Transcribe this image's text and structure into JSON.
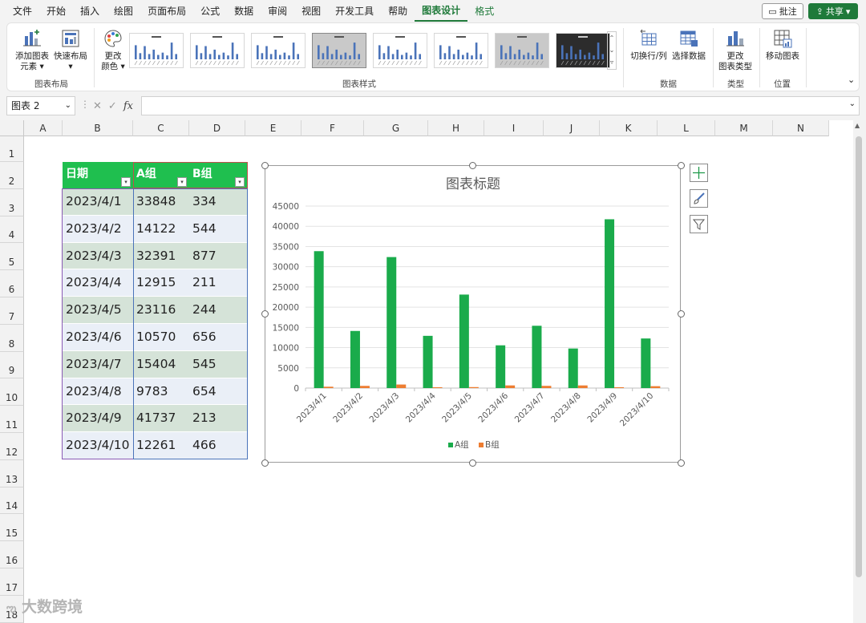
{
  "menu": [
    "文件",
    "开始",
    "插入",
    "绘图",
    "页面布局",
    "公式",
    "数据",
    "审阅",
    "视图",
    "开发工具",
    "帮助",
    "图表设计",
    "格式"
  ],
  "menu_active": "图表设计",
  "topright": {
    "comment": "批注",
    "share": "共享"
  },
  "ribbon": {
    "add_element_line1": "添加图表",
    "add_element_line2": "元素",
    "quick_layout": "快速布局",
    "change_color_line1": "更改",
    "change_color_line2": "颜色",
    "group_layout": "图表布局",
    "group_styles": "图表样式",
    "switch_row_col": "切换行/列",
    "select_data": "选择数据",
    "group_data": "数据",
    "change_type_line1": "更改",
    "change_type_line2": "图表类型",
    "group_type": "类型",
    "move_chart": "移动图表",
    "group_location": "位置"
  },
  "formula_bar": {
    "name_box": "图表 2",
    "fx": "fx"
  },
  "columns": [
    "A",
    "B",
    "C",
    "D",
    "E",
    "F",
    "G",
    "H",
    "I",
    "J",
    "K",
    "L",
    "M",
    "N"
  ],
  "rows": [
    "1",
    "2",
    "3",
    "4",
    "5",
    "6",
    "7",
    "8",
    "9",
    "10",
    "11",
    "12",
    "13",
    "14",
    "15",
    "16",
    "17",
    "18"
  ],
  "table": {
    "headers": [
      "日期",
      "A组",
      "B组"
    ],
    "rows": [
      [
        "2023/4/1",
        "33848",
        "334"
      ],
      [
        "2023/4/2",
        "14122",
        "544"
      ],
      [
        "2023/4/3",
        "32391",
        "877"
      ],
      [
        "2023/4/4",
        "12915",
        "211"
      ],
      [
        "2023/4/5",
        "23116",
        "244"
      ],
      [
        "2023/4/6",
        "10570",
        "656"
      ],
      [
        "2023/4/7",
        "15404",
        "545"
      ],
      [
        "2023/4/8",
        "9783",
        "654"
      ],
      [
        "2023/4/9",
        "41737",
        "213"
      ],
      [
        "2023/4/10",
        "12261",
        "466"
      ]
    ]
  },
  "colors": {
    "accent_green": "#1f7a3a",
    "header_green": "#1fbf4f",
    "series_a": "#1aab4b",
    "series_b": "#ed7d31",
    "row_alt_a": "#d5e3d8",
    "row_alt_b": "#eaeff7"
  },
  "chart_data": {
    "type": "bar",
    "title": "图表标题",
    "categories": [
      "2023/4/1",
      "2023/4/2",
      "2023/4/3",
      "2023/4/4",
      "2023/4/5",
      "2023/4/6",
      "2023/4/7",
      "2023/4/8",
      "2023/4/9",
      "2023/4/10"
    ],
    "series": [
      {
        "name": "A组",
        "values": [
          33848,
          14122,
          32391,
          12915,
          23116,
          10570,
          15404,
          9783,
          41737,
          12261
        ]
      },
      {
        "name": "B组",
        "values": [
          334,
          544,
          877,
          211,
          244,
          656,
          545,
          654,
          213,
          466
        ]
      }
    ],
    "ylim": [
      0,
      45000
    ],
    "yticks": [
      0,
      5000,
      10000,
      15000,
      20000,
      25000,
      30000,
      35000,
      40000,
      45000
    ],
    "grid": true,
    "legend": "bottom"
  },
  "watermark": "大数跨境"
}
